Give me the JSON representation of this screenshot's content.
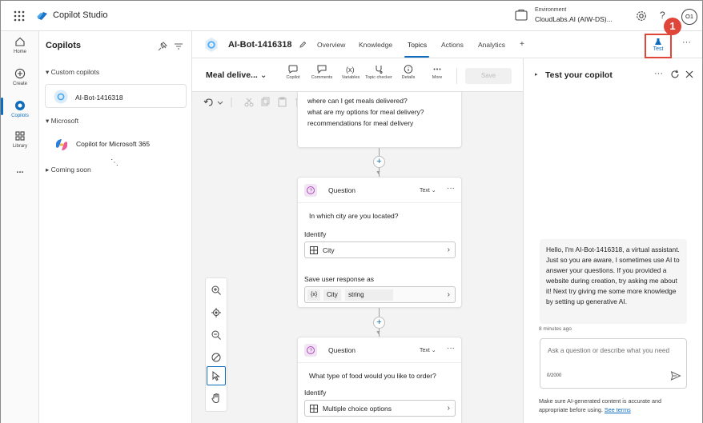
{
  "app": {
    "title": "Copilot Studio"
  },
  "environment": {
    "label": "Environment",
    "value": "CloudLabs.AI (AIW-DS)..."
  },
  "avatar": {
    "initials": "O1"
  },
  "help": {
    "glyph": "?"
  },
  "rail": {
    "items": [
      {
        "label": "Home",
        "icon": "home-icon"
      },
      {
        "label": "Create",
        "icon": "add-circle-icon"
      },
      {
        "label": "Copilots",
        "icon": "copilot-icon",
        "active": true
      },
      {
        "label": "Library",
        "icon": "library-icon"
      },
      {
        "label": "...",
        "icon": "more-icon"
      }
    ]
  },
  "copilots_panel": {
    "title": "Copilots",
    "custom_section": "Custom copilots",
    "custom_bot": "AI-Bot-1416318",
    "microsoft_section": "Microsoft",
    "microsoft_bot": "Copilot for Microsoft 365",
    "coming_soon": "Coming soon"
  },
  "bot_header": {
    "name": "AI-Bot-1416318",
    "tabs": [
      "Overview",
      "Knowledge",
      "Topics",
      "Actions",
      "Analytics",
      "+"
    ],
    "active_tab": "Topics",
    "test_label": "Test",
    "callout_number": "1",
    "more": "···"
  },
  "toolbar": {
    "topic_name": "Meal delive...",
    "items": [
      {
        "label": "Copilot",
        "icon": "copilot-chat-icon"
      },
      {
        "label": "Comments",
        "icon": "comment-icon"
      },
      {
        "label": "Variables",
        "icon": "variable-icon"
      },
      {
        "label": "Topic checker",
        "icon": "stethoscope-icon"
      },
      {
        "label": "Details",
        "icon": "info-icon"
      },
      {
        "label": "More",
        "icon": "more-icon"
      }
    ],
    "save_label": "Save"
  },
  "canvas": {
    "trigger_phrases": [
      "where can I get meals delivered?",
      "what are my options for meal delivery?",
      "recommendations for meal delivery"
    ],
    "question1": {
      "title": "Question",
      "type": "Text",
      "text": "In which city are you located?",
      "identify_label": "Identify",
      "identify_value": "City",
      "save_label": "Save user response as",
      "var_prefix": "{x}",
      "var_name": "City",
      "var_type": "string"
    },
    "question2": {
      "title": "Question",
      "type": "Text",
      "text": "What type of food would you like to order?",
      "identify_label": "Identify",
      "identify_value": "Multiple choice options"
    }
  },
  "test_panel": {
    "title": "Test your copilot",
    "message": "Hello, I'm AI-Bot-1416318, a virtual assistant. Just so you are aware, I sometimes use AI to answer your questions. If you provided a website during creation, try asking me about it! Next try giving me some more knowledge by setting up generative AI.",
    "timestamp": "8 minutes ago",
    "input_placeholder": "Ask a question or describe what you need",
    "char_count": "0/2000",
    "disclaimer": "Make sure AI-generated content is accurate and appropriate before using.",
    "see_terms": "See terms"
  }
}
